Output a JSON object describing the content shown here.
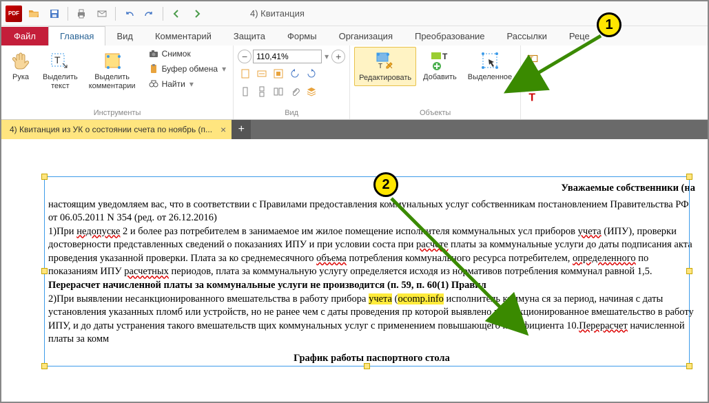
{
  "window": {
    "title": "4) Квитанция"
  },
  "tabs": {
    "file": "Файл",
    "items": [
      "Главная",
      "Вид",
      "Комментарий",
      "Защита",
      "Формы",
      "Организация",
      "Преобразование",
      "Рассылки",
      "Реце"
    ],
    "active_index": 0
  },
  "ribbon": {
    "tools_group": {
      "label": "Инструменты",
      "hand": "Рука",
      "select_text": "Выделить\nтекст",
      "select_comments": "Выделить\nкомментарии",
      "snapshot": "Снимок",
      "clipboard": "Буфер обмена",
      "find": "Найти"
    },
    "view_group": {
      "label": "Вид",
      "zoom": "110,41%"
    },
    "objects_group": {
      "label": "Объекты",
      "edit": "Редактировать",
      "add": "Добавить",
      "selected": "Выделенное"
    }
  },
  "doc_tab": {
    "title": "4) Квитанция из УК о состоянии счета по ноябрь (п..."
  },
  "document": {
    "heading_right": "Уважаемые собственники (на",
    "p1a": "настоящим уведомляем вас, что в соответствии с Правилами предоставления коммунальных услуг собственникам постановлением Правительства РФ от 06.05.2011 N 354 (ред. от 26.12.2016)",
    "p2_pre": "1)При ",
    "p2_u1": "недопуске",
    "p2_a": " 2 и более раз потребителем в занимаемое им жилое помещение исполнителя коммунальных усл приборов ",
    "p2_u2": "учета",
    "p2_b": " (ИПУ), проверки достоверности представленных сведений о показаниях ИПУ и при условии соста при ",
    "p2_u3": "расчете",
    "p2_c": " платы за коммунальные услуги до даты подписания акта проведения указанной проверки. Плата за ко среднемесячного ",
    "p2_u4": "объема",
    "p2_d": " потребления коммунального ресурса потребителем, ",
    "p2_u5": "определенного",
    "p2_e": " по показаниям ИПУ ",
    "p2_u6": "расчетных",
    "p2_f": " периодов, плата за коммунальную услугу определяется исходя из нормативов потребления коммунал равной 1,5. ",
    "p2_bold": "Перерасчет начисленной платы за коммунальные услуги не производится (п. 59, п. 60(1) Правил",
    "p3_a": "2)При выявлении несанкционированного вмешательства в работу прибора ",
    "p3_hl1": "учета",
    "p3_b": " (",
    "p3_hl2": "ocomp.info",
    "p3_c": " исполнитель коммуна ся за период, начиная с даты установления указанных пломб или устройств, но не ранее чем с даты проведения пр которой выявлено несанкционированное вмешательство в работу ИПУ, и до даты устранения такого вмешательств щих коммунальных услуг с применением повышающего коэффициента 10.",
    "p3_u1": "Перерасчет",
    "p3_d": " начисленной платы за комм",
    "heading_center": "График работы паспортного стола"
  },
  "callouts": {
    "c1": "1",
    "c2": "2"
  }
}
